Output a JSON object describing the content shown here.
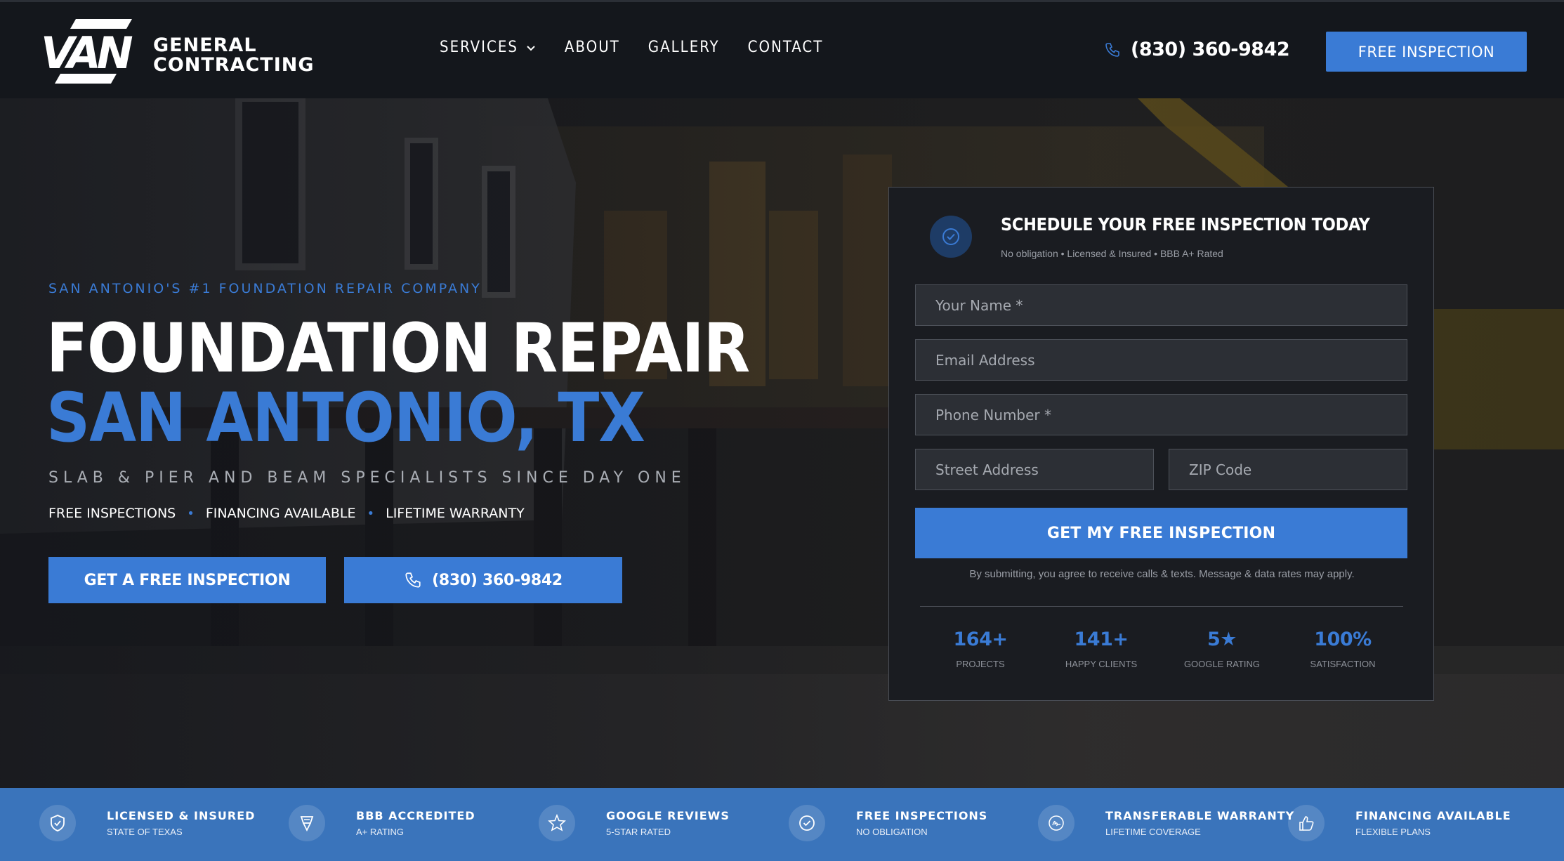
{
  "brand": {
    "logo_word": "VAN",
    "line1": "GENERAL",
    "line2": "CONTRACTING"
  },
  "nav": {
    "items": [
      {
        "label": "SERVICES",
        "has_dropdown": true,
        "icon": "chevron-down-icon"
      },
      {
        "label": "ABOUT"
      },
      {
        "label": "GALLERY"
      },
      {
        "label": "CONTACT"
      }
    ]
  },
  "header": {
    "phone": "(830) 360-9842",
    "phone_icon": "phone-icon",
    "cta": "FREE INSPECTION"
  },
  "hero": {
    "eyebrow": "SAN ANTONIO'S #1 FOUNDATION REPAIR COMPANY",
    "title_line1": "FOUNDATION REPAIR",
    "title_line2": "SAN ANTONIO, TX",
    "subtitle": "SLAB & PIER AND BEAM SPECIALISTS SINCE DAY ONE",
    "features": [
      "FREE INSPECTIONS",
      "FINANCING AVAILABLE",
      "LIFETIME WARRANTY"
    ],
    "separator": "•",
    "primary_button": "GET A FREE INSPECTION",
    "phone_button": "(830) 360-9842"
  },
  "form": {
    "title": "SCHEDULE YOUR FREE INSPECTION TODAY",
    "subtitle": "No obligation • Licensed & Insured • BBB A+ Rated",
    "icon": "check-circle-icon",
    "fields": {
      "name": "Your Name *",
      "email": "Email Address",
      "phone": "Phone Number *",
      "street": "Street Address",
      "zip": "ZIP Code"
    },
    "submit": "GET MY FREE INSPECTION",
    "disclaimer": "By submitting, you agree to receive calls & texts. Message & data rates may apply.",
    "stats": [
      {
        "value": "164+",
        "label": "PROJECTS"
      },
      {
        "value": "141+",
        "label": "HAPPY CLIENTS"
      },
      {
        "value": "5★",
        "label": "GOOGLE RATING"
      },
      {
        "value": "100%",
        "label": "SATISFACTION"
      }
    ]
  },
  "trust_bar": [
    {
      "title": "LICENSED & INSURED",
      "subtitle": "STATE OF TEXAS",
      "icon": "shield-check-icon"
    },
    {
      "title": "BBB ACCREDITED",
      "subtitle": "A+ RATING",
      "icon": "award-icon"
    },
    {
      "title": "GOOGLE REVIEWS",
      "subtitle": "5-STAR RATED",
      "icon": "star-icon"
    },
    {
      "title": "FREE INSPECTIONS",
      "subtitle": "NO OBLIGATION",
      "icon": "check-circle-icon"
    },
    {
      "title": "TRANSFERABLE WARRANTY",
      "subtitle": "LIFETIME COVERAGE",
      "icon": "signature-icon"
    },
    {
      "title": "FINANCING AVAILABLE",
      "subtitle": "FLEXIBLE PLANS",
      "icon": "thumbs-up-icon"
    }
  ],
  "colors": {
    "accent": "#3a7bd5",
    "header_bg": "#14171c",
    "card_bg": "#1a1c21",
    "trust_bg": "#3a74bb"
  }
}
